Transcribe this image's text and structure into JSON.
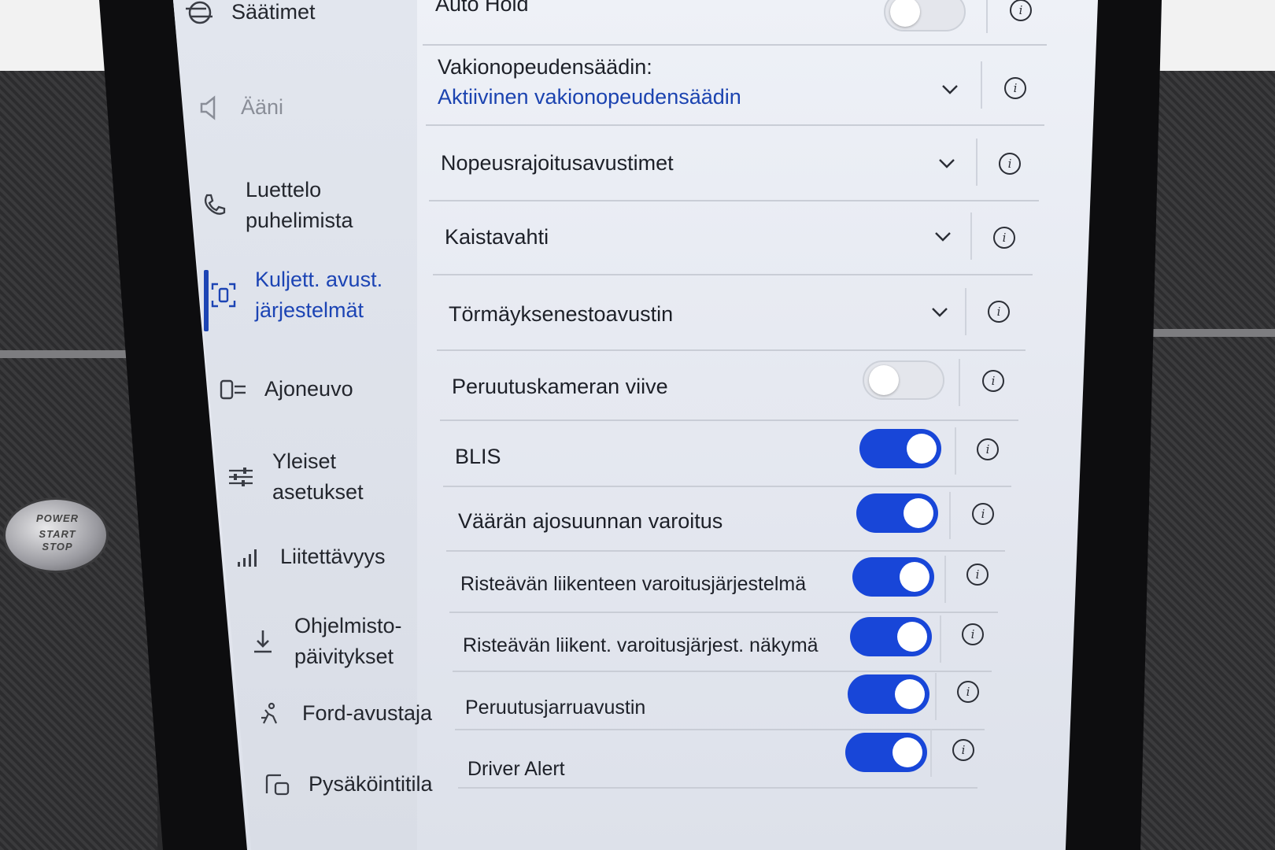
{
  "sidebar": {
    "items": [
      {
        "label": "Säätimet",
        "icon": "sliders-icon",
        "state": "normal"
      },
      {
        "label": "Ääni",
        "icon": "speaker-icon",
        "state": "disabled"
      },
      {
        "label_line1": "Luettelo",
        "label_line2": "puhelimista",
        "icon": "phone-icon",
        "state": "normal"
      },
      {
        "label_line1": "Kuljett. avust.",
        "label_line2": "järjestelmät",
        "icon": "driver-assist-icon",
        "state": "active"
      },
      {
        "label": "Ajoneuvo",
        "icon": "vehicle-icon",
        "state": "normal"
      },
      {
        "label_line1": "Yleiset",
        "label_line2": "asetukset",
        "icon": "settings-sliders-icon",
        "state": "normal"
      },
      {
        "label": "Liitettävyys",
        "icon": "signal-icon",
        "state": "normal"
      },
      {
        "label_line1": "Ohjelmisto-",
        "label_line2": "päivitykset",
        "icon": "download-icon",
        "state": "normal"
      },
      {
        "label": "Ford-avustaja",
        "icon": "assistant-icon",
        "state": "normal"
      },
      {
        "label": "Pysäköintitila",
        "icon": "parking-icon",
        "state": "normal"
      }
    ]
  },
  "main": {
    "rows": [
      {
        "label": "Auto Hold",
        "control": "toggle",
        "on": false
      },
      {
        "label": "Vakionopeudensäädin:",
        "value": "Aktiivinen vakionopeudensäädin",
        "control": "dropdown"
      },
      {
        "label": "Nopeusrajoitusavustimet",
        "control": "dropdown"
      },
      {
        "label": "Kaistavahti",
        "control": "dropdown"
      },
      {
        "label": "Törmäyksenestoavustin",
        "control": "dropdown"
      },
      {
        "label": "Peruutuskameran viive",
        "control": "toggle",
        "on": false
      },
      {
        "label": "BLIS",
        "control": "toggle",
        "on": true
      },
      {
        "label": "Väärän ajosuunnan varoitus",
        "control": "toggle",
        "on": true
      },
      {
        "label": "Risteävän liikenteen varoitusjärjestelmä",
        "control": "toggle",
        "on": true
      },
      {
        "label": "Risteävän liikent. varoitusjärjest. näkymä",
        "control": "toggle",
        "on": true
      },
      {
        "label": "Peruutusjarruavustin",
        "control": "toggle",
        "on": true
      },
      {
        "label": "Driver Alert",
        "control": "toggle",
        "on": true
      }
    ],
    "info_glyph": "i"
  },
  "hardware": {
    "power_button_line1": "POWER",
    "power_button_line2": "START",
    "power_button_line3": "STOP"
  },
  "colors": {
    "accent": "#1c44b4",
    "toggle_on": "#1846d8",
    "toggle_off": "#e4e6ec",
    "screen_bg": "#e6e9f1"
  }
}
